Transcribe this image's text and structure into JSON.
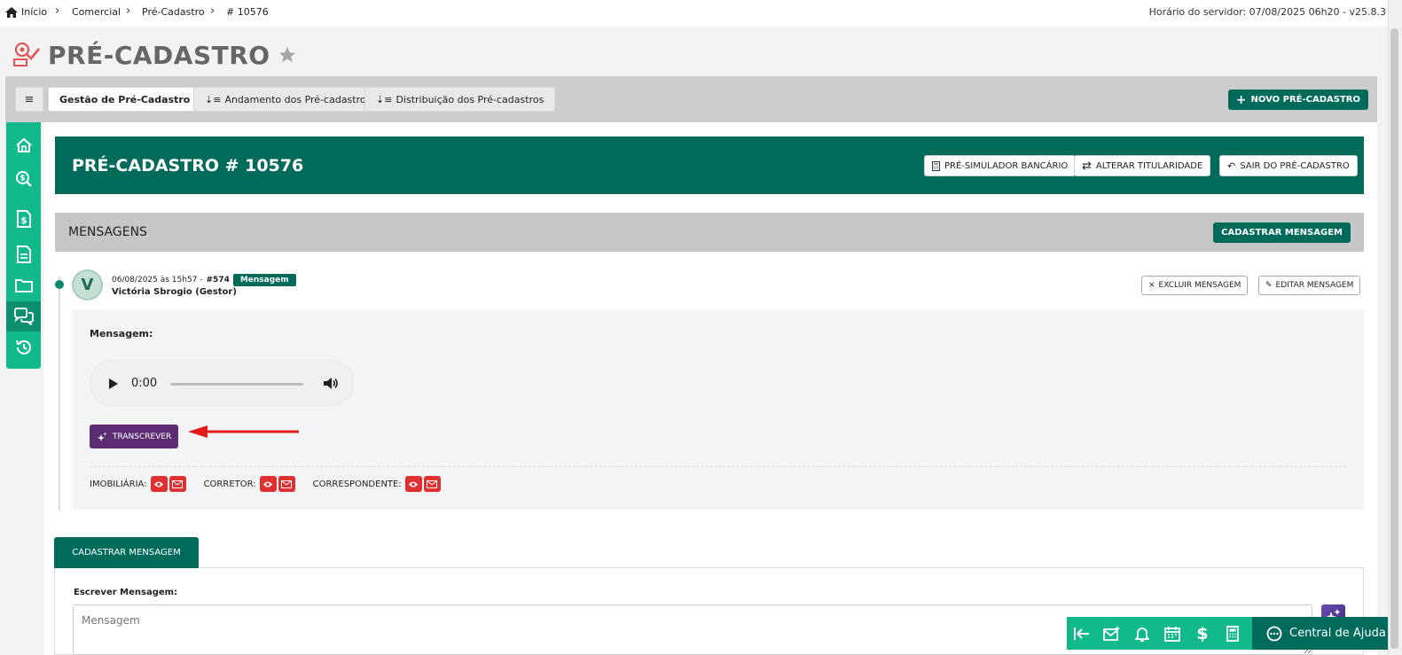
{
  "breadcrumb": {
    "items": [
      "Início",
      "Comercial",
      "Pré-Cadastro",
      "# 10576"
    ]
  },
  "server_time": "Horário do servidor: 07/08/2025 06h20 - v25.8.3",
  "page": {
    "title": "PRÉ-CADASTRO"
  },
  "nav": {
    "tabs": [
      {
        "label": "Gestão de Pré-Cadastro"
      },
      {
        "label": "Andamento dos Pré-cadastros"
      },
      {
        "label": "Distribuição dos Pré-cadastros"
      }
    ],
    "new_button": "NOVO PRÉ-CADASTRO"
  },
  "header": {
    "title": "PRÉ-CADASTRO # 10576",
    "buttons": [
      "PRÉ-SIMULADOR BANCÁRIO",
      "ALTERAR TITULARIDADE",
      "SAIR DO PRÉ-CADASTRO"
    ]
  },
  "messages": {
    "title": "MENSAGENS",
    "add_button": "CADASTRAR MENSAGEM",
    "item": {
      "avatar": "V",
      "datetime": "06/08/2025 às 15h57 -",
      "number": "#574",
      "badge": "Mensagem",
      "author": "Victória Sbrogio (Gestor)",
      "delete_button": "EXCLUIR MENSAGEM",
      "edit_button": "EDITAR MENSAGEM",
      "label": "Mensagem:",
      "audio_time": "0:00",
      "transcribe_button": "TRANSCREVER",
      "recipients": [
        "IMOBILIÁRIA:",
        "CORRETOR:",
        "CORRESPONDENTE:"
      ]
    }
  },
  "form": {
    "tab": "CADASTRAR MENSAGEM",
    "label": "Escrever Mensagem:",
    "placeholder": "Mensagem"
  },
  "bottombar": {
    "help": "Central de Ajuda"
  },
  "colors": {
    "primary": "#006b5a",
    "accent": "#12b98a",
    "purple": "#5c2d73",
    "danger": "#e03030"
  }
}
